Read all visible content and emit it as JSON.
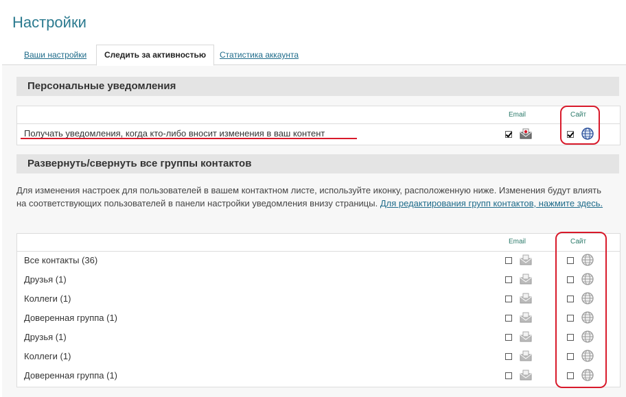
{
  "page": {
    "title": "Настройки"
  },
  "tabs": [
    {
      "label": "Ваши настройки",
      "active": false
    },
    {
      "label": "Следить за активностью",
      "active": true
    },
    {
      "label": "Статистика аккаунта",
      "active": false
    }
  ],
  "personal": {
    "header": "Персональные уведомления",
    "col_email": "Email",
    "col_site": "Сайт",
    "row": {
      "label": "Получать уведомления, когда кто-либо вносит изменения в ваш контент",
      "email_checked": true,
      "site_checked": true
    }
  },
  "groups": {
    "header": "Развернуть/свернуть все группы контактов",
    "description": "Для изменения настроек для пользователей в вашем контактном листе, используйте иконку, расположенную ниже. Изменения будут влиять на соответствующих пользователей в панели настройки уведомления внизу страницы. ",
    "edit_link": "Для редактирования групп контактов, нажмите здесь.",
    "col_email": "Email",
    "col_site": "Сайт",
    "rows": [
      {
        "label": "Все контакты (36)"
      },
      {
        "label": "Друзья (1)"
      },
      {
        "label": "Коллеги (1)"
      },
      {
        "label": "Доверенная группа (1)"
      },
      {
        "label": "Друзья (1)"
      },
      {
        "label": "Коллеги (1)"
      },
      {
        "label": "Доверенная группа (1)"
      }
    ]
  },
  "colors": {
    "accent": "#2b7a8f",
    "link": "#1e6b8a",
    "highlight": "#d8192a"
  }
}
